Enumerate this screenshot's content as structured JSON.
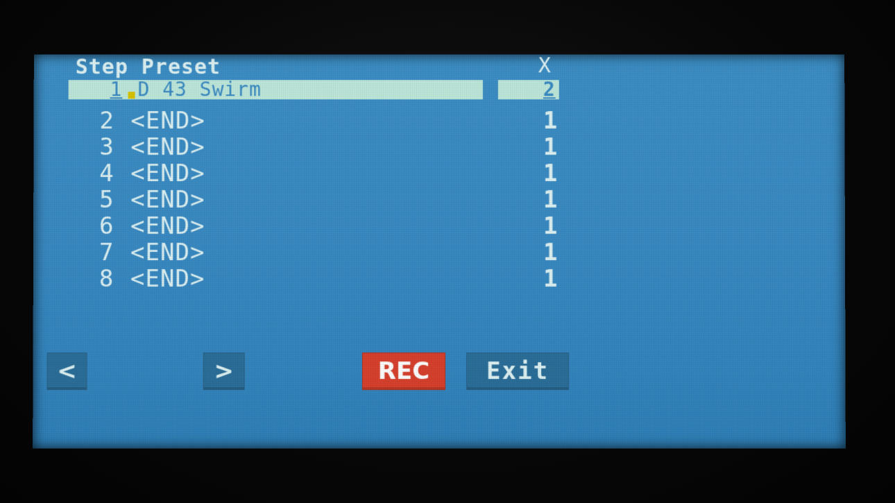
{
  "header": {
    "title": "Step Preset",
    "column_label": "X"
  },
  "rows": [
    {
      "num": "1",
      "name": "D 43 Swirm",
      "x": "2",
      "selected": true
    },
    {
      "num": "2",
      "name": "<END>",
      "x": "1"
    },
    {
      "num": "3",
      "name": "<END>",
      "x": "1"
    },
    {
      "num": "4",
      "name": "<END>",
      "x": "1"
    },
    {
      "num": "5",
      "name": "<END>",
      "x": "1"
    },
    {
      "num": "6",
      "name": "<END>",
      "x": "1"
    },
    {
      "num": "7",
      "name": "<END>",
      "x": "1"
    },
    {
      "num": "8",
      "name": "<END>",
      "x": "1"
    }
  ],
  "buttons": {
    "prev": "<",
    "next": ">",
    "rec": "REC",
    "exit": "Exit"
  },
  "colors": {
    "screen": "#3a8bc4",
    "text": "#dff3f4",
    "selection": "#bfe9dc",
    "rec": "#d8412d"
  }
}
